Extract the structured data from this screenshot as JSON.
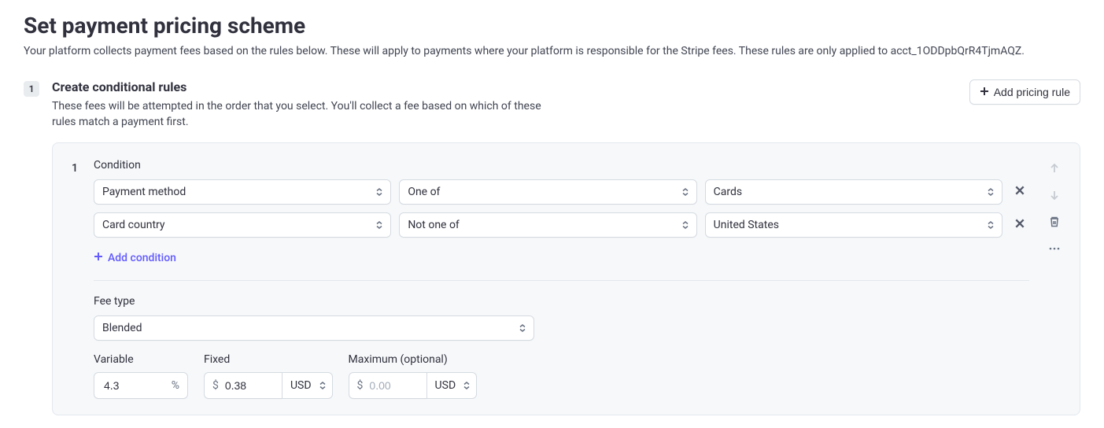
{
  "page_title": "Set payment pricing scheme",
  "page_subtitle": "Your platform collects payment fees based on the rules below. These will apply to payments where your platform is responsible for the Stripe fees. These rules are only applied to acct_1ODDpbQrR4TjmAQZ.",
  "step": {
    "number": "1",
    "title": "Create conditional rules",
    "description": "These fees will be attempted in the order that you select. You'll collect a fee based on which of these rules match a payment first.",
    "add_rule_label": "Add pricing rule"
  },
  "rule": {
    "index": "1",
    "condition_label": "Condition",
    "conditions": [
      {
        "attr": "Payment method",
        "op": "One of",
        "val": "Cards"
      },
      {
        "attr": "Card country",
        "op": "Not one of",
        "val": "United States"
      }
    ],
    "add_condition_label": "Add condition",
    "fee_type_label": "Fee type",
    "fee_type_value": "Blended",
    "variable": {
      "label": "Variable",
      "value": "4.3",
      "unit": "%"
    },
    "fixed": {
      "label": "Fixed",
      "prefix": "$",
      "value": "0.38",
      "currency": "USD"
    },
    "maximum": {
      "label": "Maximum (optional)",
      "prefix": "$",
      "placeholder": "0.00",
      "currency": "USD"
    }
  }
}
